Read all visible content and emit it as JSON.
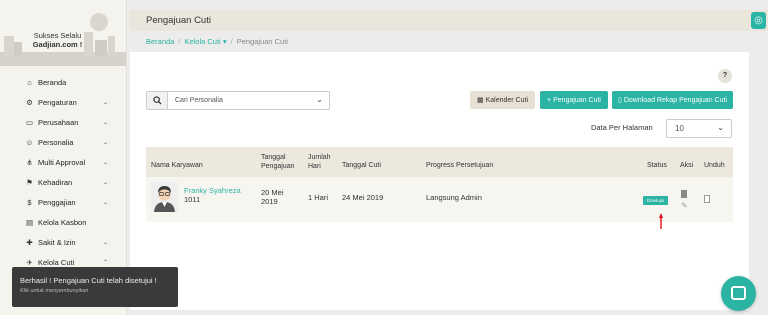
{
  "brand": {
    "tagline": "Sukses Selalu",
    "name": "Gadjian.com !"
  },
  "sidebar": {
    "items": [
      {
        "label": "Beranda",
        "icon": "home-icon",
        "glyph": "⌂",
        "chevron": ""
      },
      {
        "label": "Pengaturan",
        "icon": "gears-icon",
        "glyph": "⚙",
        "chevron": "⌄"
      },
      {
        "label": "Perusahaan",
        "icon": "folder-icon",
        "glyph": "▭",
        "chevron": "⌄"
      },
      {
        "label": "Personalia",
        "icon": "smile-icon",
        "glyph": "☺",
        "chevron": "⌄"
      },
      {
        "label": "Multi Approval",
        "icon": "sitemap-icon",
        "glyph": "⋔",
        "chevron": "⌄"
      },
      {
        "label": "Kehadiran",
        "icon": "flag-icon",
        "glyph": "⚑",
        "chevron": "⌄"
      },
      {
        "label": "Penggajian",
        "icon": "dollar-icon",
        "glyph": "$",
        "chevron": "⌄"
      },
      {
        "label": "Kelola Kasbon",
        "icon": "ticket-icon",
        "glyph": "▤",
        "chevron": ""
      },
      {
        "label": "Sakit & Izin",
        "icon": "medkit-icon",
        "glyph": "✚",
        "chevron": "⌄"
      },
      {
        "label": "Kelola Cuti",
        "icon": "plane-icon",
        "glyph": "✈",
        "chevron": "⌃"
      }
    ]
  },
  "header": {
    "title": "Pengajuan Cuti",
    "corner_glyph": "◎"
  },
  "breadcrumb": {
    "home": "Beranda",
    "section": "Kelola Cuti",
    "section_caret": "▾",
    "current": "Pengajuan Cuti",
    "separator": "/"
  },
  "toolbar": {
    "help": "?",
    "search_icon": "🔍",
    "search_value": "Cari Personalia",
    "btn_calendar": "Kalender Cuti",
    "btn_add": "Pengajuan Cuti",
    "btn_download": "Download Rekap Pengajuan Cuti",
    "per_page_label": "Data Per Halaman",
    "per_page_value": "10",
    "caret": "⌄"
  },
  "table": {
    "headers": {
      "name": "Nama Karyawan",
      "submit_date_line1": "Tanggal",
      "submit_date_line2": "Pengajuan",
      "count_line1": "Jumlah",
      "count_line2": "Hari",
      "leave_date": "Tanggal Cuti",
      "progress": "Progress Persetujuan",
      "status": "Status",
      "action": "Aksi",
      "download": "Unduh"
    },
    "rows": [
      {
        "name": "Franky Syahreza",
        "id": "1011",
        "submit_date_line1": "20 Mei",
        "submit_date_line2": "2019",
        "count": "1 Hari",
        "leave_date": "24 Mei 2019",
        "progress": "Langsung Admin",
        "status": "Disetujui"
      }
    ]
  },
  "toast": {
    "message": "Berhasil ! Pengajuan Cuti telah disetujui !",
    "hint": "Klik untuk menyembunyikan"
  },
  "colors": {
    "accent": "#2bb3a3",
    "arrow": "#e0101a"
  }
}
